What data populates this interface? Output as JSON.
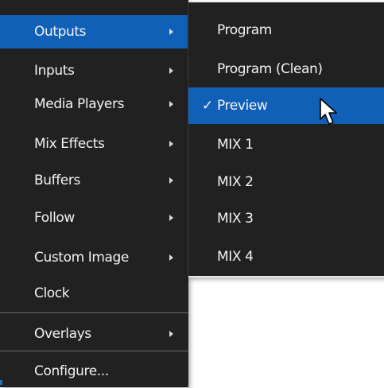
{
  "main_menu": {
    "items": [
      {
        "label": "Outputs",
        "has_submenu": true,
        "highlighted": true
      },
      {
        "label": "Inputs",
        "has_submenu": true
      },
      {
        "label": "Media Players",
        "has_submenu": true
      },
      {
        "label": "Mix Effects",
        "has_submenu": true
      },
      {
        "label": "Buffers",
        "has_submenu": true
      },
      {
        "label": "Follow",
        "has_submenu": true
      },
      {
        "label": "Custom Image",
        "has_submenu": true
      },
      {
        "label": "Clock",
        "has_submenu": false
      },
      {
        "label": "Overlays",
        "has_submenu": true
      },
      {
        "label": "Configure...",
        "has_submenu": false
      }
    ]
  },
  "submenu": {
    "items": [
      {
        "label": "Program"
      },
      {
        "label": "Program (Clean)"
      },
      {
        "label": "Preview",
        "checked": true,
        "highlighted": true,
        "check_glyph": "✓"
      },
      {
        "label": "MIX 1"
      },
      {
        "label": "MIX 2"
      },
      {
        "label": "MIX 3"
      },
      {
        "label": "MIX 4"
      }
    ]
  },
  "colors": {
    "menu_background": "#212121",
    "highlight": "#1160b8",
    "text": "#f2f2f2"
  },
  "icons": {
    "submenu_arrow": "triangle-right-icon",
    "cursor": "mouse-pointer-icon"
  }
}
